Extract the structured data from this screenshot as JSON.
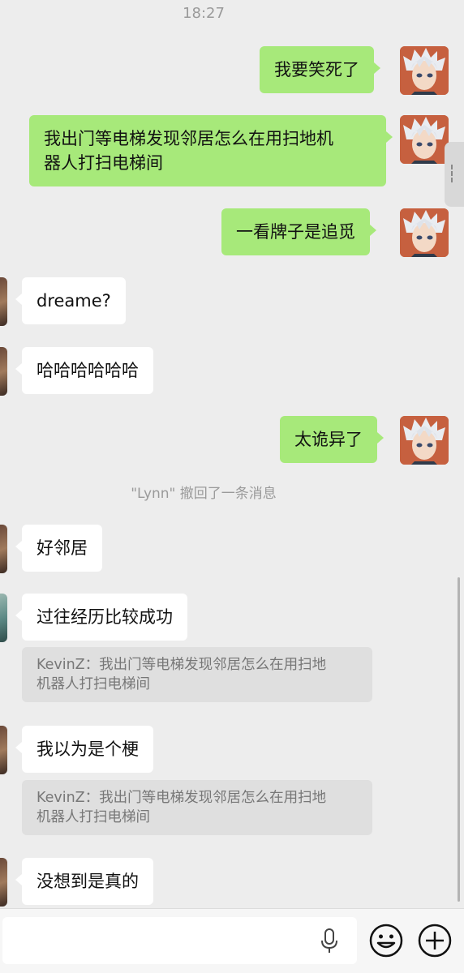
{
  "status": {
    "time": "18:27"
  },
  "messages": [
    {
      "side": "me",
      "text": "我要笑死了"
    },
    {
      "side": "me",
      "line1": "我出门等电梯发现邻居怎么在用扫地机",
      "line2": "器人打扫电梯间"
    },
    {
      "side": "me",
      "text": "一看牌子是追觅"
    },
    {
      "side": "them",
      "text": "dreame?"
    },
    {
      "side": "them",
      "text": "哈哈哈哈哈哈"
    },
    {
      "side": "me",
      "text": "太诡异了"
    },
    {
      "side": "them",
      "text": "好邻居"
    },
    {
      "side": "them",
      "text": "过往经历比较成功",
      "quote_line1": "KevinZ：我出门等电梯发现邻居怎么在用扫地",
      "quote_line2": "机器人打扫电梯间"
    },
    {
      "side": "them",
      "text": "我以为是个梗",
      "quote_line1": "KevinZ：我出门等电梯发现邻居怎么在用扫地",
      "quote_line2": "机器人打扫电梯间"
    },
    {
      "side": "them",
      "text": "没想到是真的"
    }
  ],
  "system_notice": "\"Lynn\" 撤回了一条消息",
  "input": {
    "placeholder": ""
  },
  "icons": {
    "mic": "microphone-icon",
    "emoji": "emoji-icon",
    "plus": "plus-icon"
  },
  "colors": {
    "me_bubble": "#a7e97a",
    "them_bubble": "#ffffff",
    "background": "#ededed"
  }
}
